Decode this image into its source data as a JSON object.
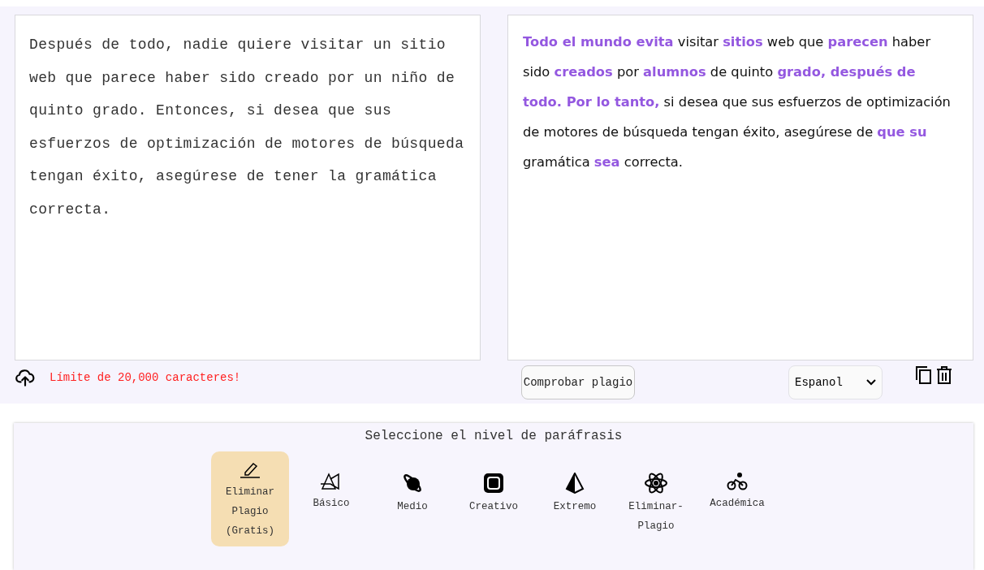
{
  "input_text": "Después de todo, nadie quiere visitar un sitio web que parece haber sido creado por un niño de quinto grado. Entonces, si desea que sus esfuerzos de optimización de motores de búsqueda tengan éxito, asegúrese de tener la gramática correcta.",
  "output_segments": [
    {
      "text": "Todo el mundo evita",
      "changed": true
    },
    {
      "text": " visitar ",
      "changed": false
    },
    {
      "text": "sitios",
      "changed": true
    },
    {
      "text": " web que ",
      "changed": false
    },
    {
      "text": "parecen",
      "changed": true
    },
    {
      "text": " haber sido ",
      "changed": false
    },
    {
      "text": "creados",
      "changed": true
    },
    {
      "text": " por ",
      "changed": false
    },
    {
      "text": "alumnos",
      "changed": true
    },
    {
      "text": " de quinto ",
      "changed": false
    },
    {
      "text": "grado, después de todo. Por lo tanto,",
      "changed": true
    },
    {
      "text": " si desea que sus esfuerzos de optimización de motores de búsqueda tengan éxito, asegúrese de ",
      "changed": false
    },
    {
      "text": "que su",
      "changed": true
    },
    {
      "text": " gramática ",
      "changed": false
    },
    {
      "text": "sea",
      "changed": true
    },
    {
      "text": " correcta.",
      "changed": false
    }
  ],
  "limit_note": "Límite de 20,000 caracteres!",
  "check_button": "Comprobar plagio",
  "language_select": {
    "value": "Espanol"
  },
  "levels_title": "Seleccione el nivel de paráfrasis",
  "levels": [
    {
      "kind": "pen",
      "label": "Eliminar Plagio (Gratis)",
      "selected": true
    },
    {
      "kind": "prism",
      "label": "Básico",
      "selected": false
    },
    {
      "kind": "planet",
      "label": "Medio",
      "selected": false
    },
    {
      "kind": "square",
      "label": "Creativo",
      "selected": false
    },
    {
      "kind": "pyramid",
      "label": "Extremo",
      "selected": false
    },
    {
      "kind": "atom",
      "label": "Eliminar-Plagio",
      "selected": false
    },
    {
      "kind": "bike",
      "label": "Académica",
      "selected": false
    }
  ]
}
